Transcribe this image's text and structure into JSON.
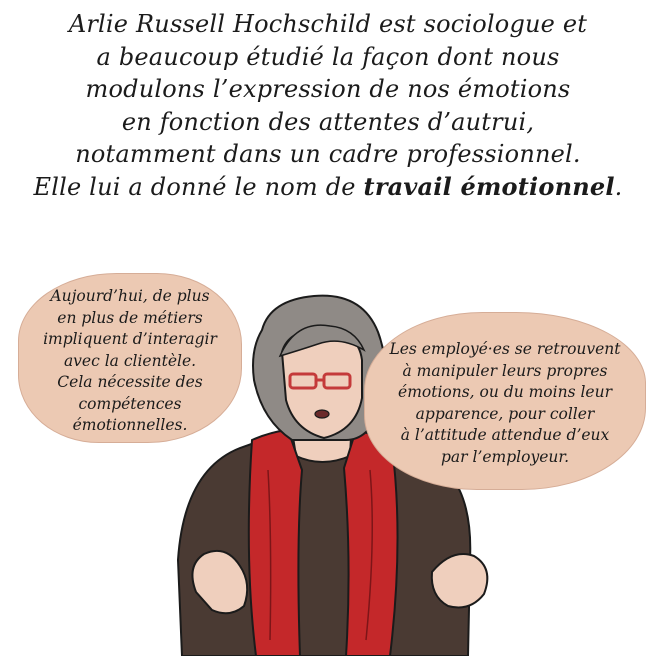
{
  "caption": {
    "lines": [
      "Arlie Russell Hochschild est sociologue et",
      "a beaucoup étudié la façon dont nous",
      "modulons l’expression de nos émotions",
      "en fonction des attentes d’autrui,",
      "notamment dans un cadre professionnel."
    ],
    "last_line_prefix": "Elle lui a donné le nom de ",
    "last_line_emphasis": "travail émotionnel",
    "last_line_suffix": "."
  },
  "bubble_left": {
    "lines": [
      "Aujourd’hui, de plus",
      "en plus de métiers",
      "impliquent d’interagir",
      "avec la clientèle.",
      "Cela nécessite des",
      "compétences",
      "émotionnelles."
    ]
  },
  "bubble_right": {
    "lines": [
      "Les employé·es se retrouvent",
      "à manipuler leurs propres",
      "émotions, ou du moins leur",
      "apparence, pour coller",
      "à l’attitude attendue d’eux",
      "par l’employeur."
    ]
  },
  "colors": {
    "bubble_fill": "#ecc9b3",
    "scarf": "#c4282a",
    "sweater": "#4a3a33",
    "hair": "#8f8a86",
    "skin": "#efcfbd",
    "glasses": "#c43a3a"
  }
}
